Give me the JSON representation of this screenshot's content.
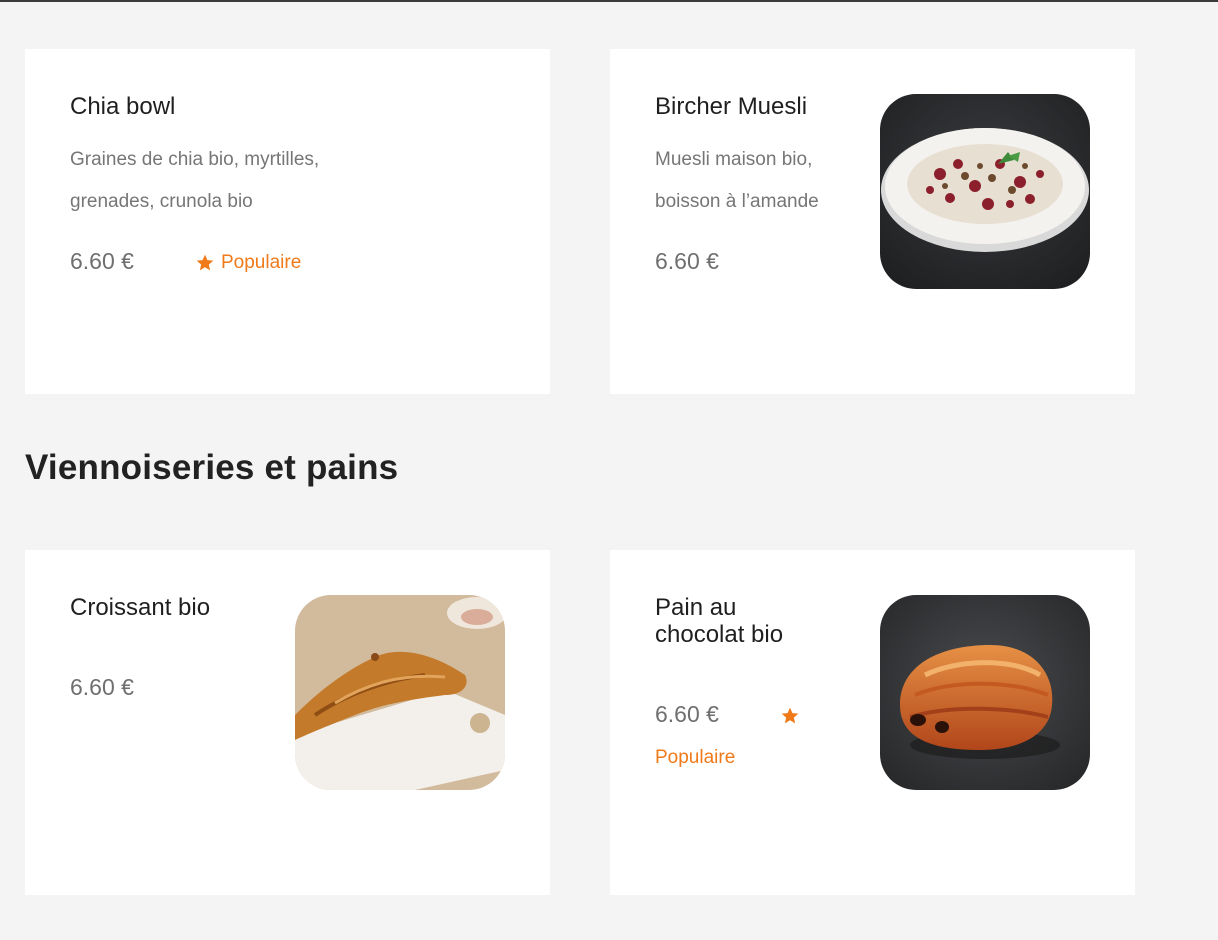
{
  "sections": [
    {
      "heading": "",
      "items": [
        {
          "name": "Chia bowl",
          "description_lines": [
            "Graines de chia bio, myrtilles,",
            "grenades, crunola bio"
          ],
          "price": "6.60 €",
          "badge": "Populaire",
          "image_icon": ""
        },
        {
          "name": "Bircher Muesli",
          "description_lines": [
            "Muesli maison bio,",
            "boisson à l’amande"
          ],
          "price": "6.60 €",
          "badge": "",
          "image_icon": "muesli-bowl-image"
        }
      ]
    },
    {
      "heading": "Viennoiseries et pains",
      "items": [
        {
          "name": "Croissant bio",
          "description_lines": [],
          "price": "6.60 €",
          "badge": "",
          "image_icon": "croissant-image"
        },
        {
          "name_lines": [
            "Pain au",
            "chocolat bio"
          ],
          "price": "6.60 €",
          "badge": "Populaire",
          "image_icon": "pain-au-chocolat-image"
        }
      ]
    }
  ],
  "colors": {
    "background": "#f3f4f3",
    "card": "#ffffff",
    "accent": "#f07a1a",
    "price_text": "#6f6f6f",
    "description_text": "#767676"
  }
}
